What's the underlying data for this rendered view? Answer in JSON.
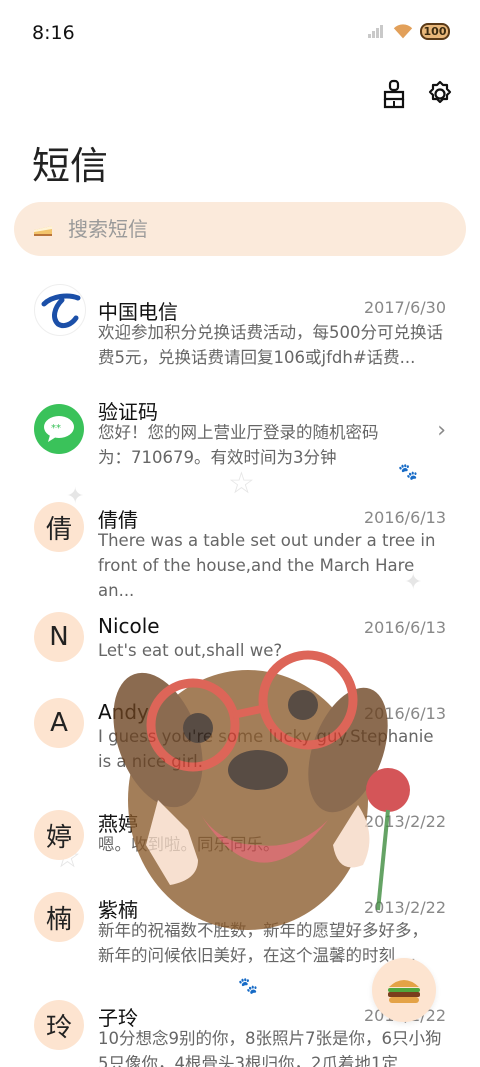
{
  "status": {
    "time": "8:16",
    "battery": "100"
  },
  "header": {
    "title": "短信"
  },
  "search": {
    "placeholder": "搜索短信"
  },
  "messages": [
    {
      "sender": "中国电信",
      "date": "2017/6/30",
      "avatar": "",
      "avatar_icon": "china-telecom-logo-icon",
      "preview": "欢迎参加积分兑换话费活动，每500分可兑换话费5元，兑换话费请回复106或jfdh#话费..."
    },
    {
      "sender": "验证码",
      "date": "",
      "avatar": "",
      "avatar_icon": "chat-bubble-icon",
      "preview": "您好！您的网上营业厅登录的随机密码为：710679。有效时间为3分钟"
    },
    {
      "sender": "倩倩",
      "date": "2016/6/13",
      "avatar": "倩",
      "preview": "There was a table set out under a tree in front of the house,and the March Hare an..."
    },
    {
      "sender": "Nicole",
      "date": "2016/6/13",
      "avatar": "N",
      "preview": "Let's eat out,shall we?"
    },
    {
      "sender": "Andy",
      "date": "2016/6/13",
      "avatar": "A",
      "preview": "I guess you're some lucky guy.Stephanie is a nice girl."
    },
    {
      "sender": "燕婷",
      "date": "2013/2/22",
      "avatar": "婷",
      "preview": "嗯。收到啦。同乐同乐。"
    },
    {
      "sender": "紫楠",
      "date": "2013/2/22",
      "avatar": "楠",
      "preview": "新年的祝福数不胜数，新年的愿望好多好多，新年的问候依旧美好，在这个温馨的时刻 ..."
    },
    {
      "sender": "子玲",
      "date": "2013/2/22",
      "avatar": "玲",
      "preview": "10分想念9别的你，8张照片7张是你，6只小狗5只像你，4根骨头3根归你，2爪着地1定"
    }
  ],
  "colors": {
    "accent": "#fde4d0",
    "search_bg": "#fbeadb",
    "verify_green": "#3ac25a",
    "telecom_blue": "#1b4fa8"
  }
}
